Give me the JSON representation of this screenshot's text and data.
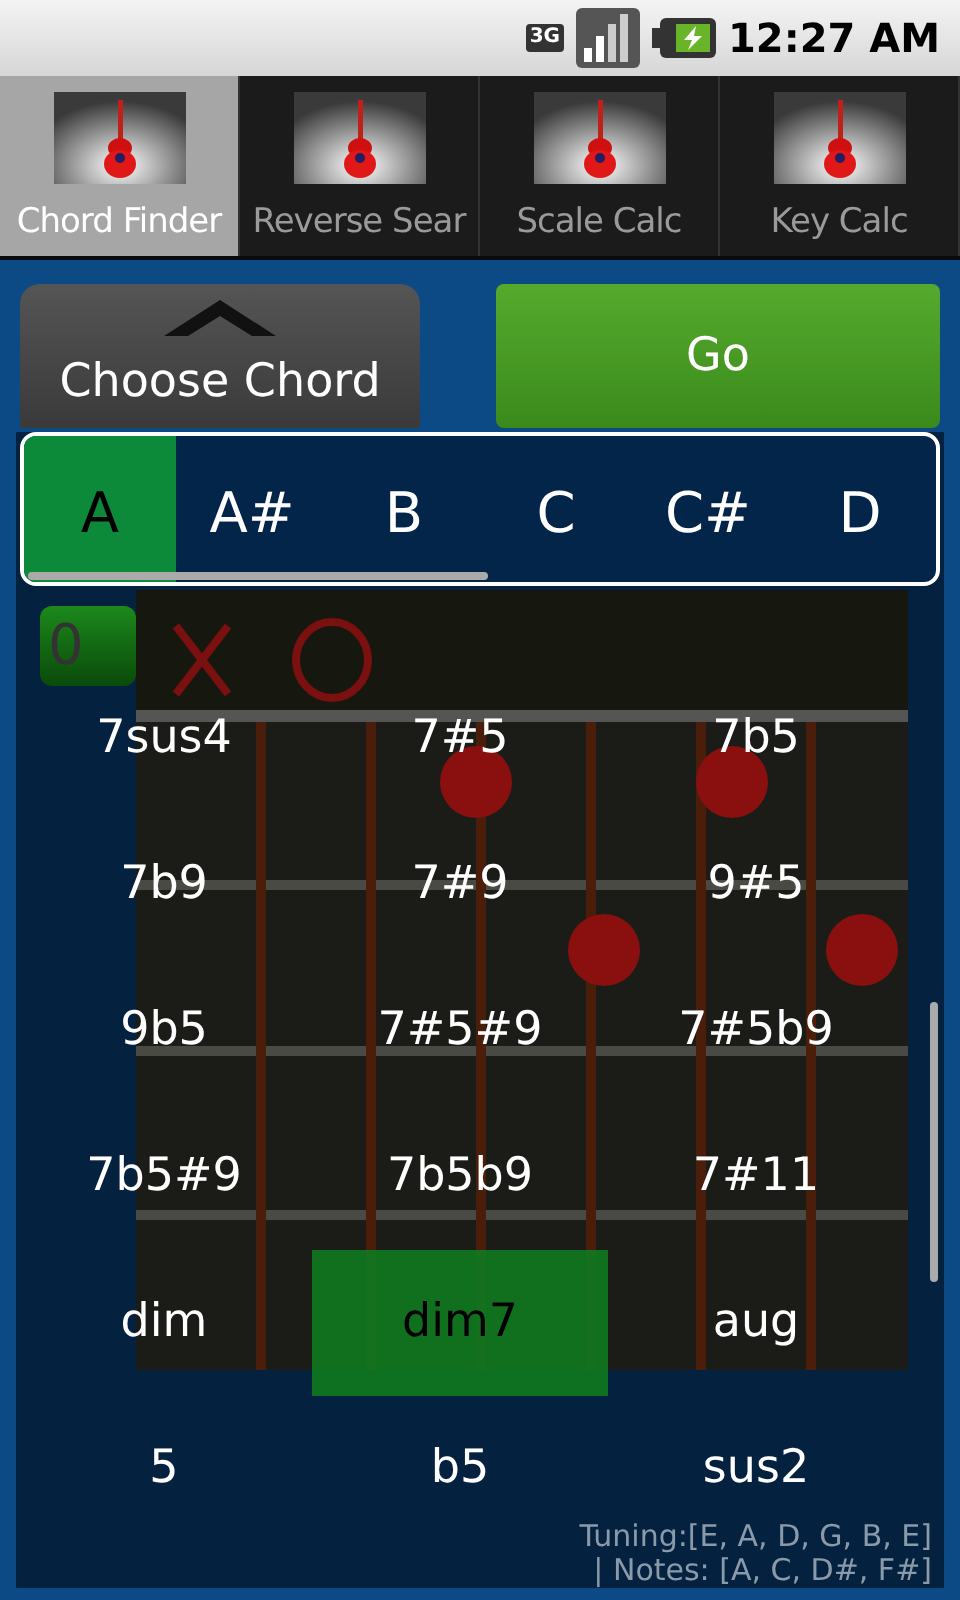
{
  "status_bar": {
    "network": "3G",
    "time": "12:27 AM"
  },
  "tabs": [
    {
      "label": "Chord Finder",
      "selected": true
    },
    {
      "label": "Reverse Sear",
      "selected": false
    },
    {
      "label": "Scale Calc",
      "selected": false
    },
    {
      "label": "Key Calc",
      "selected": false
    }
  ],
  "choose_button": {
    "label": "Choose Chord"
  },
  "go_button": {
    "label": "Go"
  },
  "notes": [
    {
      "label": "A",
      "selected": true
    },
    {
      "label": "A#",
      "selected": false
    },
    {
      "label": "B",
      "selected": false
    },
    {
      "label": "C",
      "selected": false
    },
    {
      "label": "C#",
      "selected": false
    },
    {
      "label": "D",
      "selected": false
    }
  ],
  "fret_label": "0",
  "chords": [
    {
      "label": "7sus4",
      "selected": false
    },
    {
      "label": "7#5",
      "selected": false
    },
    {
      "label": "7b5",
      "selected": false
    },
    {
      "label": "7b9",
      "selected": false
    },
    {
      "label": "7#9",
      "selected": false
    },
    {
      "label": "9#5",
      "selected": false
    },
    {
      "label": "9b5",
      "selected": false
    },
    {
      "label": "7#5#9",
      "selected": false
    },
    {
      "label": "7#5b9",
      "selected": false
    },
    {
      "label": "7b5#9",
      "selected": false
    },
    {
      "label": "7b5b9",
      "selected": false
    },
    {
      "label": "7#11",
      "selected": false
    },
    {
      "label": "dim",
      "selected": false
    },
    {
      "label": "dim7",
      "selected": true
    },
    {
      "label": "aug",
      "selected": false
    },
    {
      "label": "5",
      "selected": false
    },
    {
      "label": "b5",
      "selected": false
    },
    {
      "label": "sus2",
      "selected": false
    }
  ],
  "tuning": "Tuning:[E, A, D, G, B, E]",
  "chord_notes": "|  Notes: [A, C, D#, F#]"
}
